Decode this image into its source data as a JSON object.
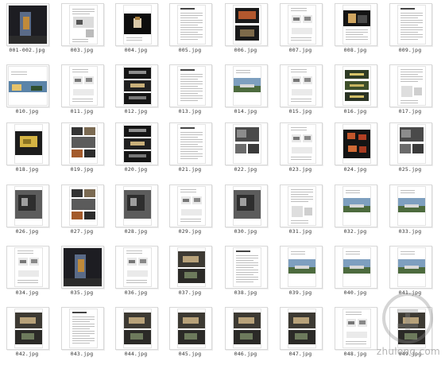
{
  "thumbnails": [
    {
      "label": "001-002.jpg",
      "style": "dark-photo"
    },
    {
      "label": "003.jpg",
      "style": "doc-diagram"
    },
    {
      "label": "004.jpg",
      "style": "black-object"
    },
    {
      "label": "005.jpg",
      "style": "text-doc"
    },
    {
      "label": "006.jpg",
      "style": "dark-split"
    },
    {
      "label": "007.jpg",
      "style": "sketch-doc"
    },
    {
      "label": "008.jpg",
      "style": "dark-photo2"
    },
    {
      "label": "009.jpg",
      "style": "text-doc"
    },
    {
      "label": "010.jpg",
      "style": "color-strip"
    },
    {
      "label": "011.jpg",
      "style": "sketch-doc"
    },
    {
      "label": "012.jpg",
      "style": "dark-stack"
    },
    {
      "label": "013.jpg",
      "style": "text-doc"
    },
    {
      "label": "014.jpg",
      "style": "landscape"
    },
    {
      "label": "015.jpg",
      "style": "sketch-doc"
    },
    {
      "label": "016.jpg",
      "style": "green-stack"
    },
    {
      "label": "017.jpg",
      "style": "text-sketch"
    },
    {
      "label": "018.jpg",
      "style": "yellow-model"
    },
    {
      "label": "019.jpg",
      "style": "photo-grid"
    },
    {
      "label": "020.jpg",
      "style": "dark-stack"
    },
    {
      "label": "021.jpg",
      "style": "text-doc"
    },
    {
      "label": "022.jpg",
      "style": "bw-photos"
    },
    {
      "label": "023.jpg",
      "style": "sketch-doc"
    },
    {
      "label": "024.jpg",
      "style": "red-objects"
    },
    {
      "label": "025.jpg",
      "style": "bw-photos"
    },
    {
      "label": "026.jpg",
      "style": "bw-photo"
    },
    {
      "label": "027.jpg",
      "style": "photo-grid"
    },
    {
      "label": "028.jpg",
      "style": "bw-photo"
    },
    {
      "label": "029.jpg",
      "style": "sketch-doc"
    },
    {
      "label": "030.jpg",
      "style": "bw-photo"
    },
    {
      "label": "031.jpg",
      "style": "text-sketch"
    },
    {
      "label": "032.jpg",
      "style": "landscape"
    },
    {
      "label": "033.jpg",
      "style": "landscape"
    },
    {
      "label": "034.jpg",
      "style": "sketch-doc"
    },
    {
      "label": "035.jpg",
      "style": "dark-photo"
    },
    {
      "label": "036.jpg",
      "style": "sketch-doc"
    },
    {
      "label": "037.jpg",
      "style": "interior"
    },
    {
      "label": "038.jpg",
      "style": "text-doc"
    },
    {
      "label": "039.jpg",
      "style": "landscape"
    },
    {
      "label": "040.jpg",
      "style": "landscape"
    },
    {
      "label": "041.jpg",
      "style": "landscape"
    },
    {
      "label": "042.jpg",
      "style": "interior"
    },
    {
      "label": "043.jpg",
      "style": "text-doc"
    },
    {
      "label": "044.jpg",
      "style": "interior"
    },
    {
      "label": "045.jpg",
      "style": "interior"
    },
    {
      "label": "046.jpg",
      "style": "interior"
    },
    {
      "label": "047.jpg",
      "style": "interior"
    },
    {
      "label": "048.jpg",
      "style": "sketch-doc"
    },
    {
      "label": "049.jpg",
      "style": "interior"
    }
  ],
  "watermark": "zhulong.com",
  "watermark_logo": "zhulong-logo-icon"
}
